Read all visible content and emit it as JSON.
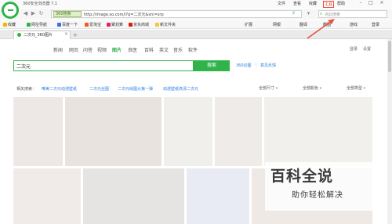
{
  "window": {
    "title": "360安全浏览器 7.1"
  },
  "menu": {
    "file": "文件",
    "view": "查看",
    "favorites": "收藏",
    "tools": "工具",
    "help": "帮助"
  },
  "window_controls": {
    "minimize": "–",
    "maximize": "□",
    "close": "×"
  },
  "address": {
    "safe_label": "360搜索",
    "url": "http://image.so.com/i?q=二次元&src=srp",
    "search_placeholder": "点此搜索"
  },
  "favorites": {
    "items": [
      "收藏",
      "网址导航",
      "百度一下",
      "爱淘宝",
      "聚划算",
      "京东商城",
      "新文件夹"
    ],
    "right_items": [
      "扩展",
      "网银",
      "翻译",
      "截图",
      "游戏",
      "登录"
    ]
  },
  "tab": {
    "title": "二次元_360图片",
    "close": "×",
    "new_tab": "+"
  },
  "categories": [
    "新闻",
    "网页",
    "问答",
    "视频",
    "图片",
    "良医",
    "百科",
    "英文",
    "音乐",
    "软件"
  ],
  "top_links": {
    "login": "登录",
    "settings": "设置"
  },
  "search": {
    "query": "二次元",
    "button": "搜索",
    "link_360": "360识图",
    "link_feedback": "意见反馈"
  },
  "related": {
    "label": "相关搜索：",
    "links": [
      "唯美二次元动漫壁纸",
      "二次元丝图",
      "二次元绘图从第一弹",
      "动漫壁纸高清二次元"
    ]
  },
  "filters": [
    "全部尺寸",
    "全部颜色",
    "全部类型"
  ],
  "watermark": {
    "title": "百科全说",
    "subtitle": "助你轻松解决"
  },
  "colors": {
    "accent": "#2fb34a",
    "link": "#2b7de1",
    "annotation": "#e8523a"
  }
}
